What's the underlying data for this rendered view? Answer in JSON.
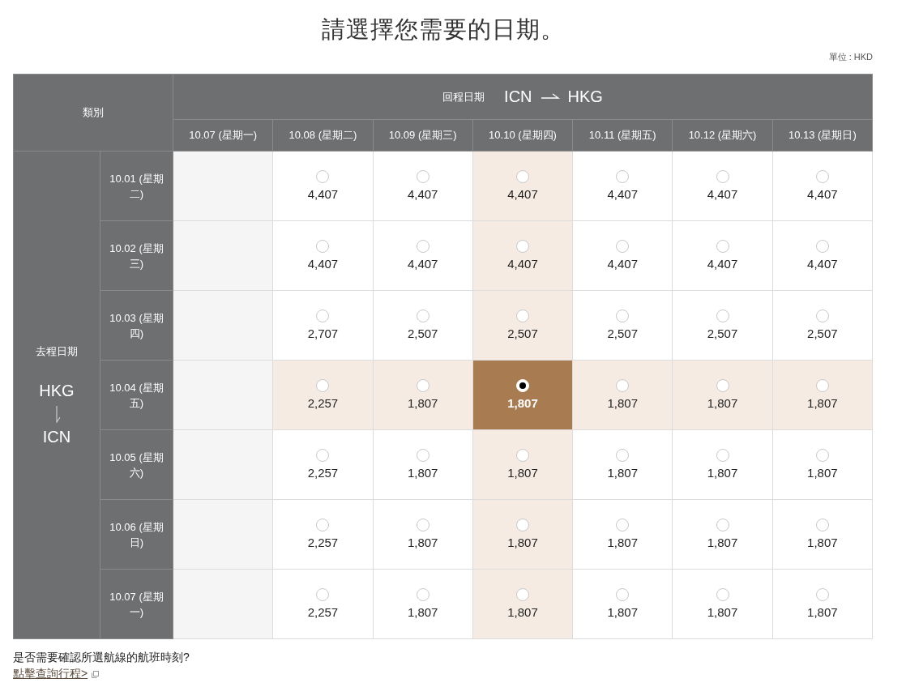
{
  "title": "請選擇您需要的日期。",
  "unit": "單位 : HKD",
  "table": {
    "category_header": "類別",
    "return_header": {
      "label": "回程日期",
      "from": "ICN",
      "to": "HKG"
    },
    "outbound_header": {
      "label": "去程日期",
      "from": "HKG",
      "to": "ICN"
    },
    "columns": [
      "10.07 (星期一)",
      "10.08 (星期二)",
      "10.09 (星期三)",
      "10.10 (星期四)",
      "10.11 (星期五)",
      "10.12 (星期六)",
      "10.13 (星期日)"
    ],
    "rows": [
      {
        "date": "10.01 (星期二)",
        "cells": [
          {
            "kind": "unavailable"
          },
          {
            "kind": "fare",
            "price": "4,407",
            "selected": false
          },
          {
            "kind": "fare",
            "price": "4,407",
            "selected": false
          },
          {
            "kind": "fare",
            "price": "4,407",
            "selected": false
          },
          {
            "kind": "fare",
            "price": "4,407",
            "selected": false
          },
          {
            "kind": "fare",
            "price": "4,407",
            "selected": false
          },
          {
            "kind": "fare",
            "price": "4,407",
            "selected": false
          }
        ]
      },
      {
        "date": "10.02 (星期三)",
        "cells": [
          {
            "kind": "unavailable"
          },
          {
            "kind": "fare",
            "price": "4,407",
            "selected": false
          },
          {
            "kind": "fare",
            "price": "4,407",
            "selected": false
          },
          {
            "kind": "fare",
            "price": "4,407",
            "selected": false
          },
          {
            "kind": "fare",
            "price": "4,407",
            "selected": false
          },
          {
            "kind": "fare",
            "price": "4,407",
            "selected": false
          },
          {
            "kind": "fare",
            "price": "4,407",
            "selected": false
          }
        ]
      },
      {
        "date": "10.03 (星期四)",
        "cells": [
          {
            "kind": "unavailable"
          },
          {
            "kind": "fare",
            "price": "2,707",
            "selected": false
          },
          {
            "kind": "fare",
            "price": "2,507",
            "selected": false
          },
          {
            "kind": "fare",
            "price": "2,507",
            "selected": false
          },
          {
            "kind": "fare",
            "price": "2,507",
            "selected": false
          },
          {
            "kind": "fare",
            "price": "2,507",
            "selected": false
          },
          {
            "kind": "fare",
            "price": "2,507",
            "selected": false
          }
        ]
      },
      {
        "date": "10.04 (星期五)",
        "cells": [
          {
            "kind": "unavailable"
          },
          {
            "kind": "fare",
            "price": "2,257",
            "selected": false
          },
          {
            "kind": "fare",
            "price": "1,807",
            "selected": false
          },
          {
            "kind": "fare",
            "price": "1,807",
            "selected": true
          },
          {
            "kind": "fare",
            "price": "1,807",
            "selected": false
          },
          {
            "kind": "fare",
            "price": "1,807",
            "selected": false
          },
          {
            "kind": "fare",
            "price": "1,807",
            "selected": false
          }
        ]
      },
      {
        "date": "10.05 (星期六)",
        "cells": [
          {
            "kind": "unavailable"
          },
          {
            "kind": "fare",
            "price": "2,257",
            "selected": false
          },
          {
            "kind": "fare",
            "price": "1,807",
            "selected": false
          },
          {
            "kind": "fare",
            "price": "1,807",
            "selected": false
          },
          {
            "kind": "fare",
            "price": "1,807",
            "selected": false
          },
          {
            "kind": "fare",
            "price": "1,807",
            "selected": false
          },
          {
            "kind": "fare",
            "price": "1,807",
            "selected": false
          }
        ]
      },
      {
        "date": "10.06 (星期日)",
        "cells": [
          {
            "kind": "unavailable"
          },
          {
            "kind": "fare",
            "price": "2,257",
            "selected": false
          },
          {
            "kind": "fare",
            "price": "1,807",
            "selected": false
          },
          {
            "kind": "fare",
            "price": "1,807",
            "selected": false
          },
          {
            "kind": "fare",
            "price": "1,807",
            "selected": false
          },
          {
            "kind": "fare",
            "price": "1,807",
            "selected": false
          },
          {
            "kind": "fare",
            "price": "1,807",
            "selected": false
          }
        ]
      },
      {
        "date": "10.07 (星期一)",
        "cells": [
          {
            "kind": "unavailable"
          },
          {
            "kind": "fare",
            "price": "2,257",
            "selected": false
          },
          {
            "kind": "fare",
            "price": "1,807",
            "selected": false
          },
          {
            "kind": "fare",
            "price": "1,807",
            "selected": false
          },
          {
            "kind": "fare",
            "price": "1,807",
            "selected": false
          },
          {
            "kind": "fare",
            "price": "1,807",
            "selected": false
          },
          {
            "kind": "fare",
            "price": "1,807",
            "selected": false
          }
        ]
      }
    ]
  },
  "footer": {
    "question": "是否需要確認所選航線的航班時刻?",
    "link": "點擊查詢行程>"
  }
}
